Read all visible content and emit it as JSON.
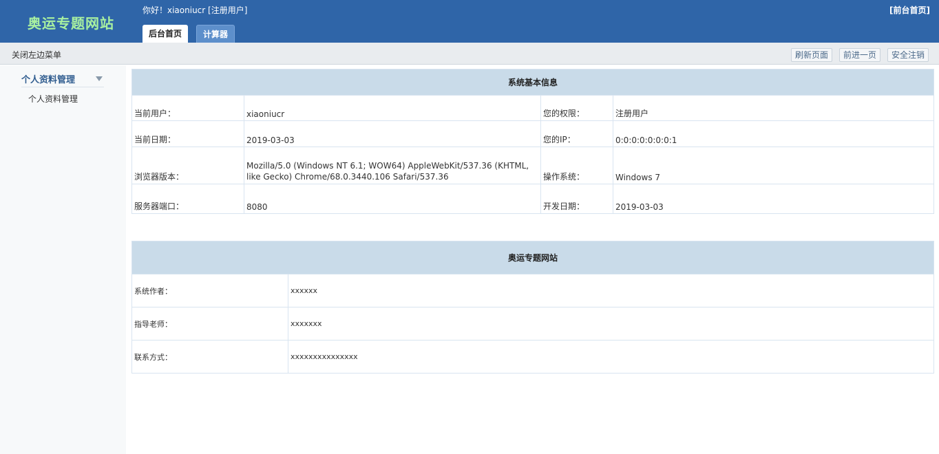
{
  "header": {
    "logo": "奥运专题网站",
    "greeting": "你好！xiaoniucr [注册用户]",
    "front_link": "[前台首页]",
    "tabs": [
      {
        "label": "后台首页"
      },
      {
        "label": "计算器"
      }
    ]
  },
  "toolbar": {
    "toggle_menu": "关闭左边菜单",
    "refresh": "刷新页面",
    "forward": "前进一页",
    "logout": "安全注销"
  },
  "sidebar": {
    "group_label": "个人资料管理",
    "items": [
      {
        "label": "个人资料管理"
      }
    ]
  },
  "system_info": {
    "title": "系统基本信息",
    "rows": [
      {
        "k1": "当前用户：",
        "v1": "xiaoniucr",
        "k2": "您的权限：",
        "v2": "注册用户"
      },
      {
        "k1": "当前日期：",
        "v1": "2019-03-03",
        "k2": "您的IP：",
        "v2": "0:0:0:0:0:0:0:1"
      },
      {
        "k1": "浏览器版本：",
        "v1": "Mozilla/5.0 (Windows NT 6.1; WOW64) AppleWebKit/537.36 (KHTML, like Gecko) Chrome/68.0.3440.106 Safari/537.36",
        "k2": "操作系统：",
        "v2": "Windows 7"
      },
      {
        "k1": "服务器端口：",
        "v1": "8080",
        "k2": "开发日期：",
        "v2": "2019-03-03"
      }
    ]
  },
  "site_info": {
    "title": "奥运专题网站",
    "rows": [
      {
        "key": "系统作者：",
        "value": "xxxxxx"
      },
      {
        "key": "指导老师：",
        "value": "xxxxxxx"
      },
      {
        "key": "联系方式：",
        "value": "xxxxxxxxxxxxxxx"
      }
    ]
  }
}
